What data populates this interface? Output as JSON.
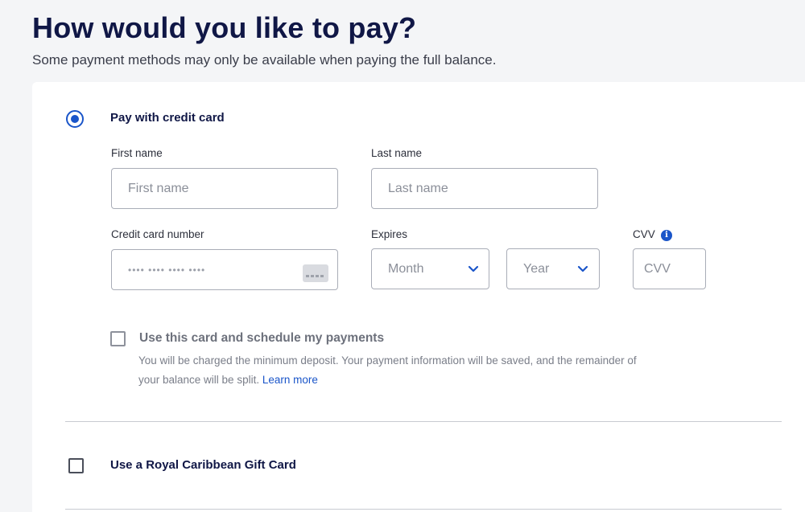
{
  "header": {
    "title": "How would you like to pay?",
    "subtitle": "Some payment methods may only be available when paying the full balance."
  },
  "credit_card_option": {
    "label": "Pay with credit card",
    "selected": true,
    "first_name": {
      "label": "First name",
      "placeholder": "First name",
      "value": ""
    },
    "last_name": {
      "label": "Last name",
      "placeholder": "Last name",
      "value": ""
    },
    "card_number": {
      "label": "Credit card number",
      "placeholder": "•••• •••• •••• ••••",
      "value": "",
      "icon": "credit-card-icon"
    },
    "expires": {
      "label": "Expires",
      "month": {
        "selected_text": "Month"
      },
      "year": {
        "selected_text": "Year"
      }
    },
    "cvv": {
      "label": "CVV",
      "placeholder": "CVV",
      "value": "",
      "info_icon": "i"
    },
    "schedule": {
      "label": "Use this card and schedule my payments",
      "checked": false,
      "helper_text": "You will be charged the minimum deposit. Your payment information will be saved, and the remainder of your balance will be split.",
      "learn_more": "Learn more"
    }
  },
  "gift_card_option": {
    "label": "Use a Royal Caribbean Gift Card",
    "checked": false
  },
  "colors": {
    "accent": "#1a55c9",
    "title": "#101746",
    "background": "#f4f5f7"
  }
}
